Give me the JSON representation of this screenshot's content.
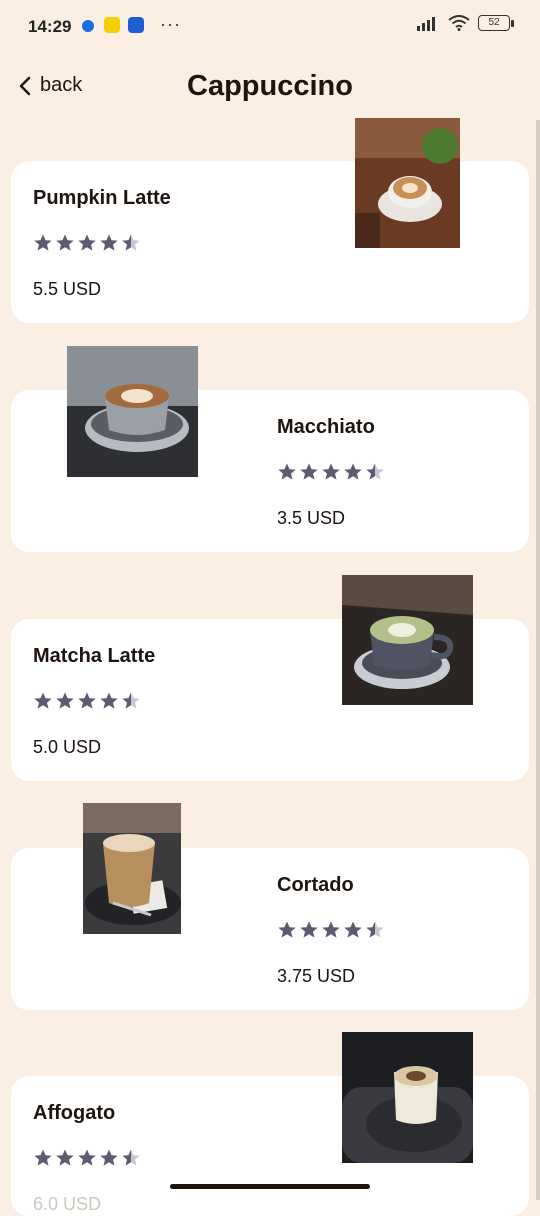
{
  "status_bar": {
    "time": "14:29",
    "battery": "52",
    "dots": "···"
  },
  "header": {
    "back_label": "back",
    "title": "Cappuccino"
  },
  "items": [
    {
      "name": "Pumpkin Latte",
      "rating": 4.5,
      "price": "5.5 USD"
    },
    {
      "name": "Macchiato",
      "rating": 4.5,
      "price": "3.5 USD"
    },
    {
      "name": "Matcha Latte",
      "rating": 4.5,
      "price": "5.0 USD"
    },
    {
      "name": "Cortado",
      "rating": 4.5,
      "price": "3.75 USD"
    },
    {
      "name": "Affogato",
      "rating": 4.5,
      "price": "6.0 USD"
    }
  ],
  "colors": {
    "background": "#fbeee2",
    "card": "#ffffff",
    "star": "#5f5a72",
    "text": "#1e1410"
  }
}
